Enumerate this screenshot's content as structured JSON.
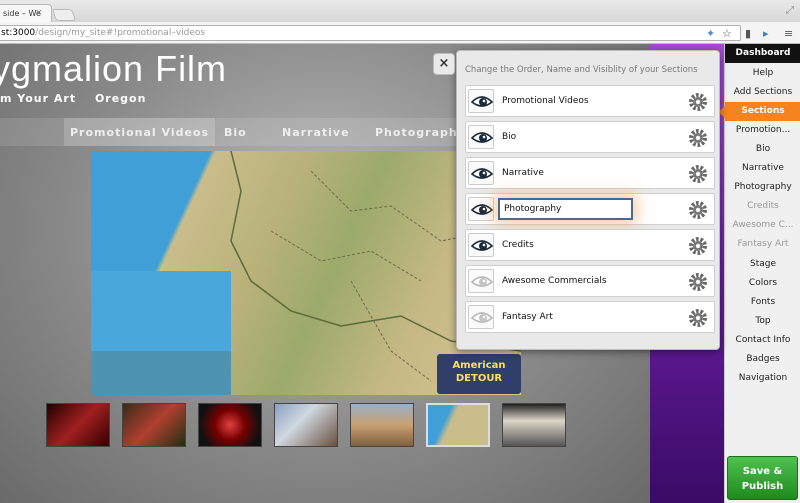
{
  "browser": {
    "tab_title": "side – We",
    "tab_close": "×",
    "url_host": "st:3000",
    "url_path": "/design/my_site#!promotional–videos"
  },
  "site": {
    "title": "ygmalion Film",
    "subtitle_left": "m Your Art",
    "subtitle_right": "Oregon",
    "nav": [
      "Promotional Videos",
      "Bio",
      "Narrative",
      "Photography"
    ],
    "badge_line1": "American",
    "badge_line2": "DETOUR"
  },
  "panel": {
    "title": "Change the Order, Name and Visiblity of your Sections",
    "close_label": "×",
    "rows": [
      {
        "label": "Promotional Videos",
        "visible": true
      },
      {
        "label": "Bio",
        "visible": true
      },
      {
        "label": "Narrative",
        "visible": true
      },
      {
        "label": "Photography",
        "visible": true,
        "editing": true
      },
      {
        "label": "Credits",
        "visible": true
      },
      {
        "label": "Awesome Commercials",
        "visible": false
      },
      {
        "label": "Fantasy Art",
        "visible": false
      }
    ]
  },
  "sidebar": {
    "items": [
      {
        "label": "Dashboard",
        "style": "dash"
      },
      {
        "label": "Help",
        "style": ""
      },
      {
        "label": "Add Sections",
        "style": ""
      },
      {
        "label": "Sections",
        "style": "sel"
      },
      {
        "label": "Promotion...",
        "style": ""
      },
      {
        "label": "Bio",
        "style": ""
      },
      {
        "label": "Narrative",
        "style": ""
      },
      {
        "label": "Photography",
        "style": ""
      },
      {
        "label": "Credits",
        "style": "dim"
      },
      {
        "label": "Awesome C...",
        "style": "dim"
      },
      {
        "label": "Fantasy Art",
        "style": "dim"
      },
      {
        "label": "Stage",
        "style": ""
      },
      {
        "label": "Colors",
        "style": ""
      },
      {
        "label": "Fonts",
        "style": ""
      },
      {
        "label": "Top",
        "style": ""
      },
      {
        "label": "Contact Info",
        "style": ""
      },
      {
        "label": "Badges",
        "style": ""
      },
      {
        "label": "Navigation",
        "style": ""
      }
    ],
    "save_line1": "Save &",
    "save_line2": "Publish"
  },
  "colors": {
    "accent_orange": "#f58320",
    "save_green": "#2fa02f",
    "purple": "#6a1ea0"
  }
}
